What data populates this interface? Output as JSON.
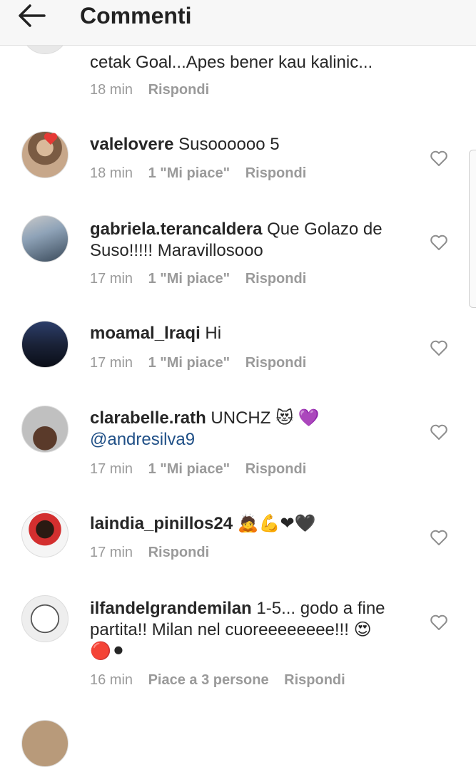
{
  "header": {
    "title": "Commenti"
  },
  "comments": [
    {
      "username": "",
      "text": "cetak Goal...Apes bener kau kalinic...",
      "time": "18 min",
      "likes": "",
      "reply": "Rispondi"
    },
    {
      "username": "valelovere",
      "text": "Susoooooo 5",
      "time": "18 min",
      "likes": "1 \"Mi piace\"",
      "reply": "Rispondi"
    },
    {
      "username": "gabriela.terancaldera",
      "text": "Que Golazo de Suso!!!!! Maravillosooo",
      "time": "17 min",
      "likes": "1 \"Mi piace\"",
      "reply": "Rispondi"
    },
    {
      "username": "moamal_lraqi",
      "text": "Hi",
      "time": "17 min",
      "likes": "1 \"Mi piace\"",
      "reply": "Rispondi"
    },
    {
      "username": "clarabelle.rath",
      "text": "UNCHZ 😻 💜",
      "mention": "@andresilva9",
      "time": "17 min",
      "likes": "1 \"Mi piace\"",
      "reply": "Rispondi"
    },
    {
      "username": "laindia_pinillos24",
      "text": "🙇💪❤🖤",
      "time": "17 min",
      "likes": "",
      "reply": "Rispondi"
    },
    {
      "username": "ilfandelgrandemilan",
      "text": "1-5... godo a fine partita!! Milan nel cuoreeeeeeee!!! 😍 🔴⚫",
      "time": "16 min",
      "likes": "Piace a 3 persone",
      "reply": "Rispondi"
    }
  ]
}
